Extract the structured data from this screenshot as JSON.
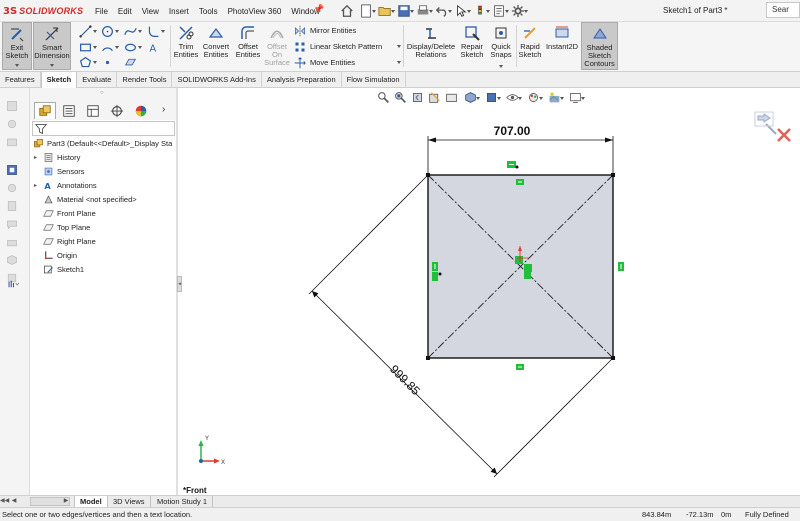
{
  "app": {
    "logo_ds": "3S",
    "logo_text": "SOLIDWORKS",
    "menu": [
      "File",
      "Edit",
      "View",
      "Insert",
      "Tools",
      "PhotoView 360",
      "Window"
    ],
    "document_title": "Sketch1 of Part3 *",
    "search_placeholder": "Sear"
  },
  "command_manager": {
    "exit_sketch": [
      "Exit",
      "Sketch"
    ],
    "smart_dimension": [
      "Smart",
      "Dimension"
    ],
    "trim_entities": [
      "Trim",
      "Entities"
    ],
    "convert_entities": [
      "Convert",
      "Entities"
    ],
    "offset_entities": [
      "Offset",
      "Entities"
    ],
    "offset_on_surface": [
      "Offset",
      "On",
      "Surface"
    ],
    "mirror_entities": "Mirror Entities",
    "linear_sketch_pattern": "Linear Sketch Pattern",
    "move_entities": "Move Entities",
    "display_delete_relations": [
      "Display/Delete",
      "Relations"
    ],
    "repair_sketch": [
      "Repair",
      "Sketch"
    ],
    "quick_snaps": [
      "Quick",
      "Snaps"
    ],
    "rapid_sketch": [
      "Rapid",
      "Sketch"
    ],
    "instant2d": [
      "Instant2D"
    ],
    "shaded_sketch_contours": [
      "Shaded",
      "Sketch",
      "Contours"
    ]
  },
  "tabs": {
    "items": [
      "Features",
      "Sketch",
      "Evaluate",
      "Render Tools",
      "SOLIDWORKS Add-Ins",
      "Analysis Preparation",
      "Flow Simulation"
    ],
    "selected": "Sketch"
  },
  "feature_tree": {
    "part": "Part3  (Default<<Default>_Display Sta",
    "history": "History",
    "sensors": "Sensors",
    "annotations": "Annotations",
    "material": "Material <not specified>",
    "front_plane": "Front Plane",
    "top_plane": "Top Plane",
    "right_plane": "Right Plane",
    "origin": "Origin",
    "sketch": "Sketch1"
  },
  "drawing": {
    "dim_horizontal": "707.00",
    "dim_diagonal": "999.85",
    "view_label": "*Front",
    "axis_x": "X",
    "axis_y": "Y"
  },
  "bottom_tabs": {
    "model": "Model",
    "views_3d": "3D Views",
    "motion_study": "Motion Study 1"
  },
  "status": {
    "message": "Select one or two edges/vertices and then a text location.",
    "x": "843.84m",
    "y": "-72.13m",
    "z": "0m",
    "state": "Fully Defined"
  },
  "colors": {
    "accent_red": "#d42a2a",
    "sketch_fill": "#d4d6e0",
    "relation_green": "#1fbf3a",
    "active_button": "#c9c9c9"
  },
  "icons": {
    "title_bar": [
      "home-icon",
      "new-document-icon",
      "open-icon",
      "save-icon",
      "print-icon",
      "undo-icon",
      "select-icon",
      "rebuild-icon",
      "file-properties-icon",
      "options-icon"
    ],
    "heads_up": [
      "zoom-to-fit-icon",
      "zoom-to-area-icon",
      "previous-view-icon",
      "section-view-icon",
      "dynamic-annotation-icon",
      "view-orientation-icon",
      "display-style-icon",
      "hide-show-icon",
      "edit-appearance-icon",
      "apply-scene-icon",
      "view-settings-icon",
      "monitor-icon"
    ]
  }
}
